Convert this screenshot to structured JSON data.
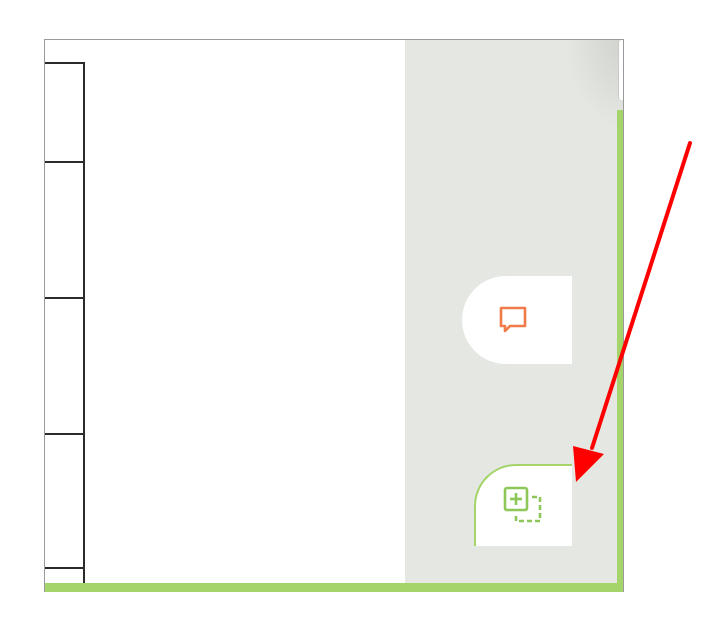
{
  "viewport": {
    "description_hidden": ""
  },
  "document": {
    "table_rows": 4
  },
  "side_panel": {
    "comment_button": {
      "icon": "comment-icon",
      "accent": "#f07a4a"
    },
    "add_button": {
      "icon": "add-copy-icon",
      "accent": "#8dc758"
    }
  },
  "colors": {
    "panel_bg": "#e5e7e3",
    "accent_green": "#a4d46a",
    "annotation_arrow": "#ff0000"
  },
  "annotation": {
    "type": "arrow",
    "points_to": "add-copy-button"
  }
}
